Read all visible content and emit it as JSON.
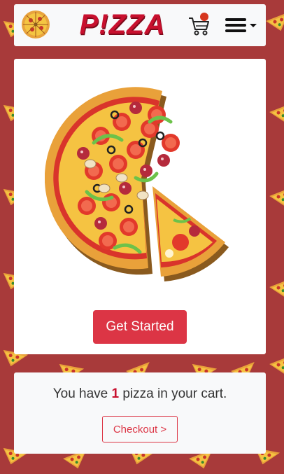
{
  "navbar": {
    "brand_text": "P!ZZA",
    "logo_icon": "pizza-logo-icon",
    "cart_icon": "shopping-cart-icon",
    "menu_icon": "hamburger-menu-icon"
  },
  "hero": {
    "image_icon": "pizza-illustration",
    "button_label": "Get Started"
  },
  "cart_summary": {
    "prefix": "You have",
    "count": "1",
    "suffix": "pizza in your cart.",
    "checkout_label": "Checkout >"
  },
  "colors": {
    "background": "#a83a3a",
    "accent": "#dc3545",
    "card": "#f8f9fa"
  }
}
